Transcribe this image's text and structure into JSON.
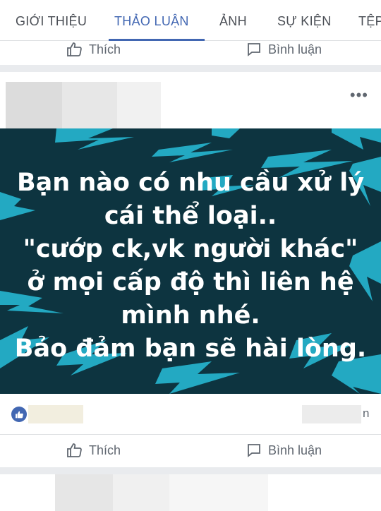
{
  "tabs": [
    {
      "label": "GIỚI THIỆU",
      "active": false
    },
    {
      "label": "THẢO LUẬN",
      "active": true
    },
    {
      "label": "ẢNH",
      "active": false
    },
    {
      "label": "SỰ KIỆN",
      "active": false
    },
    {
      "label": "TỆP",
      "active": false
    }
  ],
  "top_actions": {
    "like_label": "Thích",
    "comment_label": "Bình luận"
  },
  "post": {
    "more_icon": "ellipsis-icon",
    "image_text_lines": [
      "Bạn nào có nhu cầu xử lý",
      "cái thể loại..",
      "\"cướp ck,vk người khác\"",
      "ở mọi cấp độ thì liên hệ",
      "mình nhé.",
      "Bảo đảm bạn sẽ hài lòng."
    ],
    "reaction_icon": "like-reaction-icon",
    "comment_count_suffix": "n",
    "actions": {
      "like_label": "Thích",
      "comment_label": "Bình luận"
    }
  },
  "colors": {
    "accent": "#4267b2",
    "image_bg": "#0d3440",
    "bolt": "#23a9c2"
  }
}
